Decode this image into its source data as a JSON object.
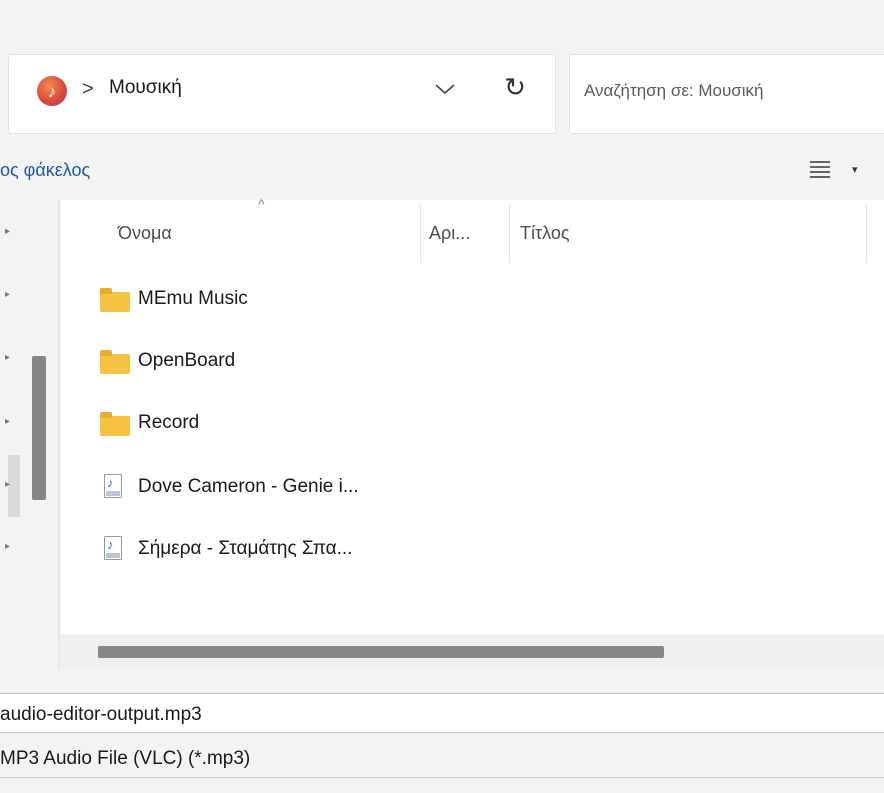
{
  "address_bar": {
    "location_icon": "music-library-icon",
    "separator": ">",
    "location": "Μουσική",
    "dropdown_icon": "chevron-down-icon",
    "refresh_icon": "refresh-icon",
    "refresh_glyph": "↻"
  },
  "search": {
    "placeholder": "Αναζήτηση σε: Μουσική"
  },
  "toolbar": {
    "new_folder_label": "ος φάκελος",
    "view_icon": "view-options-icon",
    "view_caret": "▾"
  },
  "columns": {
    "name": "Όνομα",
    "number": "Αρι...",
    "title": "Τίτλος",
    "sort_indicator": "^"
  },
  "files": [
    {
      "name": "MEmu Music",
      "type": "folder",
      "icon": "folder-icon"
    },
    {
      "name": "OpenBoard",
      "type": "folder",
      "icon": "folder-icon"
    },
    {
      "name": "Record",
      "type": "folder",
      "icon": "folder-icon"
    },
    {
      "name": "Dove Cameron - Genie i...",
      "type": "audio",
      "icon": "audio-file-icon"
    },
    {
      "name": "Σήμερα - Σταμάτης Σπα...",
      "type": "audio",
      "icon": "audio-file-icon"
    }
  ],
  "file_name": {
    "value": "audio-editor-output.mp3"
  },
  "file_type": {
    "value": "MP3 Audio File (VLC) (*.mp3)"
  },
  "colors": {
    "link": "#1c5ba6",
    "folder": "#f6c242",
    "scrollbar": "#858585"
  }
}
